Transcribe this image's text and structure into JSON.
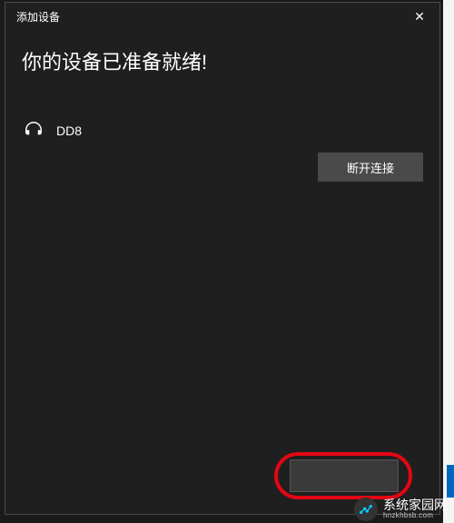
{
  "dialog": {
    "title": "添加设备",
    "heading": "你的设备已准备就绪!",
    "device": {
      "name": "DD8",
      "icon": "headphone"
    },
    "disconnect_label": "断开连接"
  },
  "watermark": {
    "main": "系统家园网",
    "sub": "hnzkhbsb.com"
  }
}
